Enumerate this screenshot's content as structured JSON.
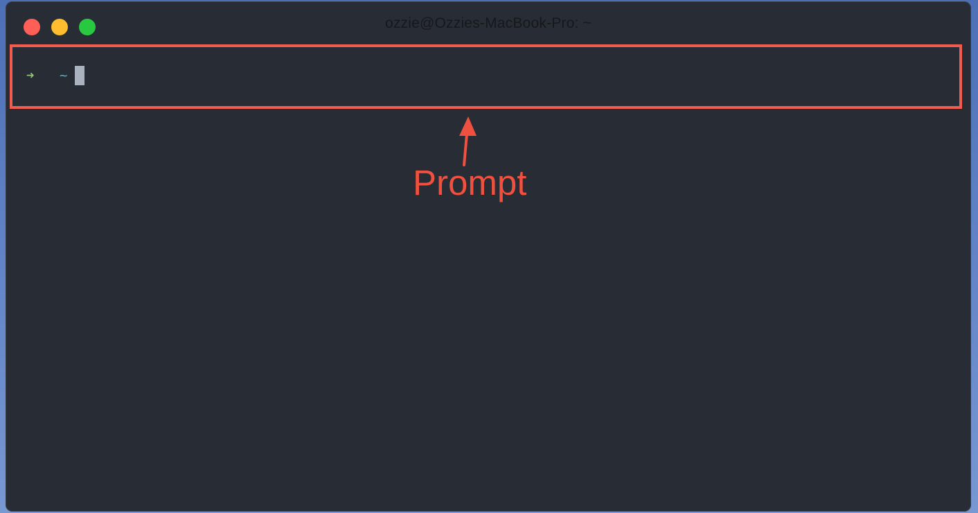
{
  "window": {
    "title": "ozzie@Ozzies-MacBook-Pro: ~",
    "buttons": {
      "close": "close-button",
      "minimize": "minimize-button",
      "zoom": "zoom-button"
    }
  },
  "terminal": {
    "prompt_arrow": "➜",
    "prompt_dir": "~",
    "input_value": ""
  },
  "annotation": {
    "label": "Prompt",
    "color": "#f0503f"
  },
  "colors": {
    "terminal_bg": "#282c34",
    "arrow_green": "#98c379",
    "dir_cyan": "#56b6c2",
    "cursor": "#abb2bf",
    "traffic_close": "#ff5f57",
    "traffic_minimize": "#febc2e",
    "traffic_zoom": "#28c840"
  }
}
